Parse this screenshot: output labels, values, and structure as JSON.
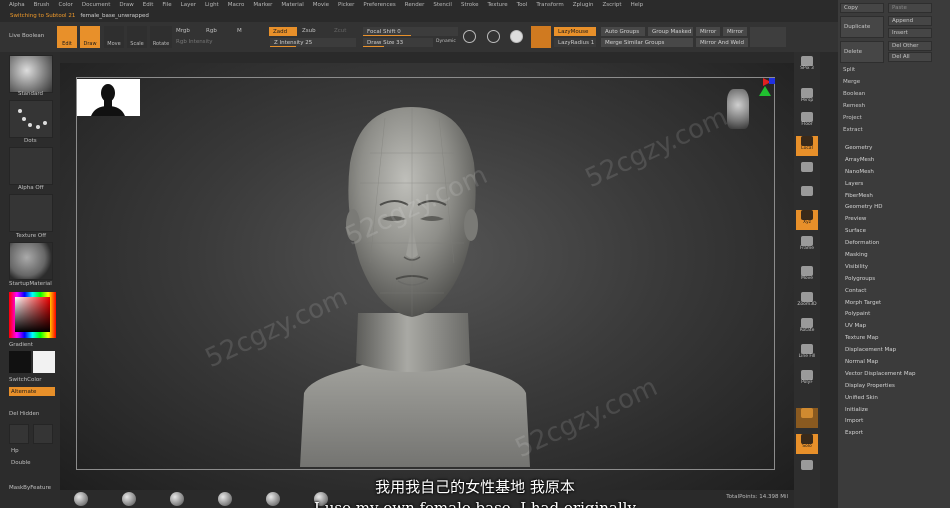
{
  "menu": [
    "Alpha",
    "Brush",
    "Color",
    "Document",
    "Draw",
    "Edit",
    "File",
    "Layer",
    "Light",
    "Macro",
    "Marker",
    "Material",
    "Movie",
    "Picker",
    "Preferences",
    "Render",
    "Stencil",
    "Stroke",
    "Texture",
    "Tool",
    "Transform",
    "Zplugin",
    "Zscript",
    "Help"
  ],
  "info": {
    "alert": "Switching to Subtool 21",
    "filename": "female_base_unwrapped"
  },
  "toolbar": {
    "live_boolean": "Live Boolean",
    "edit": "Edit",
    "draw": "Draw",
    "move": "Move",
    "scale": "Scale",
    "rotate": "Rotate",
    "mrgb": "Mrgb",
    "rgb": "Rgb",
    "m": "M",
    "rgb_intensity": "Rgb Intensity",
    "zadd": "Zadd",
    "zsub": "Zsub",
    "zcut": "Zcut",
    "z_intensity": "Z Intensity 25",
    "focal_shift": "Focal Shift 0",
    "draw_size": "Draw Size 33",
    "dynamic": "Dynamic",
    "lazymouse": "LazyMouse",
    "lazyradius": "LazyRadius 1",
    "auto_groups": "Auto Groups",
    "merge_similar": "Merge Similar Groups",
    "group_masked": "Group Masked",
    "mirror1": "Mirror",
    "mirror2": "Mirror",
    "mirror_and_weld": "Mirror And Weld"
  },
  "left": {
    "standard": "Standard",
    "dots": "Dots",
    "alpha_off": "Alpha Off",
    "texture_off": "Texture Off",
    "startup_material": "StartupMaterial",
    "gradient": "Gradient",
    "switch_color": "SwitchColor",
    "alternate": "Alternate",
    "del_hidden": "Del Hidden",
    "hp": "Hp",
    "double": "Double",
    "mask_by_feature": "MaskByFeature"
  },
  "right": {
    "spix": "SPix 3",
    "persp": "Persp",
    "floor": "Floor",
    "local": "Local",
    "xyz": "Xyz",
    "frame": "Frame",
    "move": "Move",
    "zoom3d": "Zoom3D",
    "rotate": "Rotate",
    "line_fill": "Line Fill",
    "polyf": "PolyF",
    "transp": "Transp",
    "dynamic": "Dynamic",
    "solo": "Solo"
  },
  "palette": {
    "copy": "Copy",
    "paste": "Paste",
    "duplicate": "Duplicate",
    "append": "Append",
    "insert": "Insert",
    "delete": "Delete",
    "del_other": "Del Other",
    "del_all": "Del All",
    "sub": [
      "Split",
      "Merge",
      "Boolean",
      "Remesh",
      "Project",
      "Extract"
    ],
    "items": [
      "Geometry",
      "ArrayMesh",
      "NanoMesh",
      "Layers",
      "FiberMesh",
      "Geometry HD",
      "Preview",
      "Surface",
      "Deformation",
      "Masking",
      "Visibility",
      "Polygroups",
      "Contact",
      "Morph Target",
      "Polypaint",
      "UV Map",
      "Texture Map",
      "Displacement Map",
      "Normal Map",
      "Vector Displacement Map",
      "Display Properties",
      "Unified Skin",
      "Initialize",
      "Import",
      "Export"
    ]
  },
  "bottom": {
    "total": "TotalPoints: 14.398 Mil"
  },
  "subtitles": {
    "cn": "我用我自己的女性基地 我原本",
    "en": "I use my own female base. I had originally"
  },
  "watermark": "52cgzy.com"
}
